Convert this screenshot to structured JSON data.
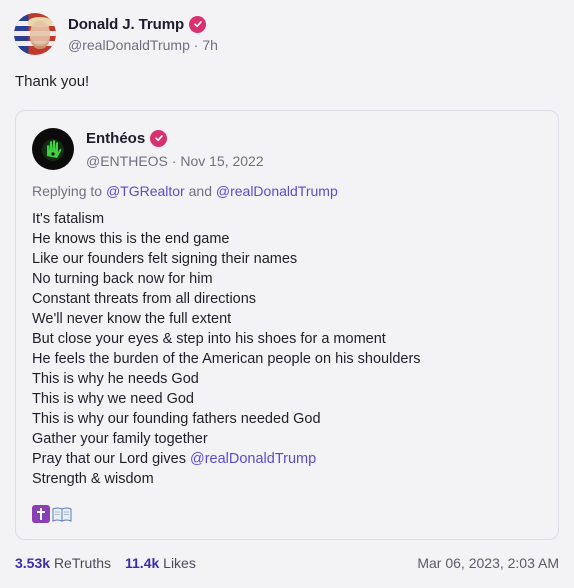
{
  "post": {
    "author": {
      "display_name": "Donald J. Trump",
      "handle": "@realDonaldTrump",
      "separator": "·",
      "time": "7h"
    },
    "text": "Thank you!",
    "quote": {
      "author": {
        "display_name": "Enthéos",
        "handle": "@ENTHEOS",
        "separator": "·",
        "date": "Nov 15, 2022"
      },
      "replying_prefix": "Replying to",
      "replying_to": [
        "@TGRealtor",
        "@realDonaldTrump"
      ],
      "replying_and": "and",
      "lines": [
        "It's fatalism",
        "He knows this is the end game",
        "Like our founders felt signing their names",
        "No turning back now for him",
        "Constant threats from all directions",
        "We'll never know the full extent",
        "But close your eyes & step into his shoes for a moment",
        "He feels the burden of the American people on his shoulders",
        "This is why he needs God",
        "This is why we need God",
        "This is why our founding fathers needed God",
        "Gather your family together",
        "Pray that our Lord gives ",
        "Strength & wisdom"
      ],
      "line_13_mention": "@realDonaldTrump",
      "emojis": [
        "latin-cross-icon",
        "open-book-icon"
      ]
    },
    "stats": {
      "retruths_count": "3.53k",
      "retruths_label": "ReTruths",
      "likes_count": "11.4k",
      "likes_label": "Likes"
    },
    "timestamp": "Mar 06, 2023, 2:03 AM"
  },
  "colors": {
    "background": "#f3f3f5",
    "verified_badge": "#d9316f",
    "mention": "#5c4bd0",
    "stat_count": "#3b2fa8",
    "secondary_text": "#6f6f82"
  }
}
